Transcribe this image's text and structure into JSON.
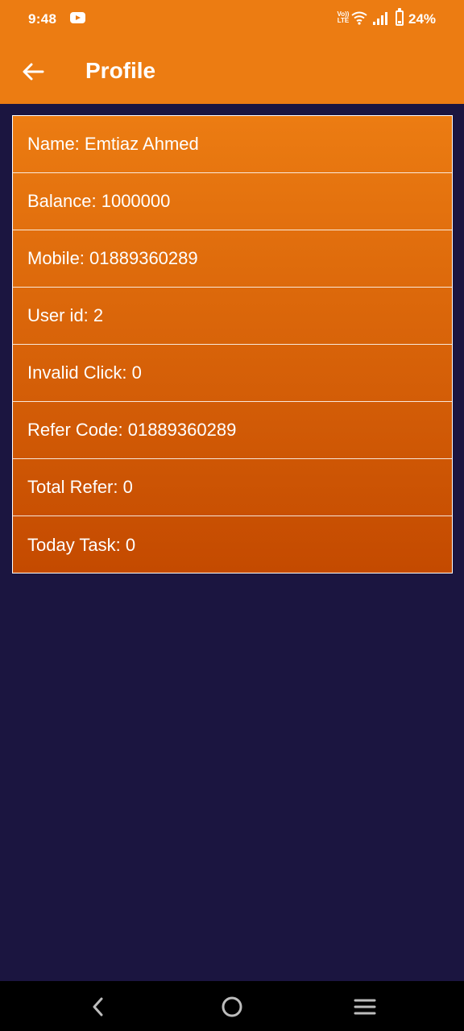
{
  "status_bar": {
    "time": "9:48",
    "network": "Vo)) LTE",
    "battery": "24%"
  },
  "header": {
    "title": "Profile"
  },
  "profile": {
    "rows": [
      {
        "label": "Name: Emtiaz Ahmed"
      },
      {
        "label": "Balance: 1000000"
      },
      {
        "label": "Mobile: 01889360289"
      },
      {
        "label": "User id: 2"
      },
      {
        "label": "Invalid Click: 0"
      },
      {
        "label": "Refer Code: 01889360289"
      },
      {
        "label": "Total Refer: 0"
      },
      {
        "label": "Today Task: 0"
      }
    ]
  },
  "colors": {
    "app_bar": "#ec7c12",
    "background": "#1b1540",
    "card_top": "#ec7c12",
    "card_bottom": "#c44a00"
  },
  "icons": [
    "youtube-icon",
    "wifi-icon",
    "signal-icon",
    "battery-icon",
    "back-arrow-icon",
    "nav-back-icon",
    "nav-home-icon",
    "nav-recents-icon"
  ]
}
